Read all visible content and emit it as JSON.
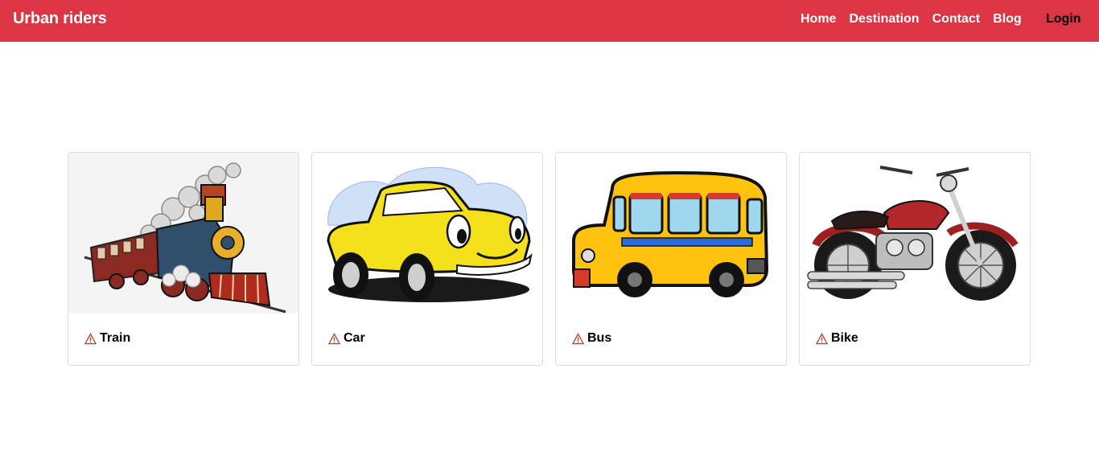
{
  "colors": {
    "brand": "#dc3545",
    "nav_text": "#ffffff",
    "login_text": "#000000"
  },
  "navbar": {
    "brand": "Urban riders",
    "links": [
      "Home",
      "Destination",
      "Contact",
      "Blog"
    ],
    "login": "Login"
  },
  "cards": [
    {
      "title": "Train",
      "image": "train-illustration",
      "icon": "warning-icon"
    },
    {
      "title": "Car",
      "image": "car-illustration",
      "icon": "warning-icon"
    },
    {
      "title": "Bus",
      "image": "bus-illustration",
      "icon": "warning-icon"
    },
    {
      "title": "Bike",
      "image": "bike-illustration",
      "icon": "warning-icon"
    }
  ]
}
